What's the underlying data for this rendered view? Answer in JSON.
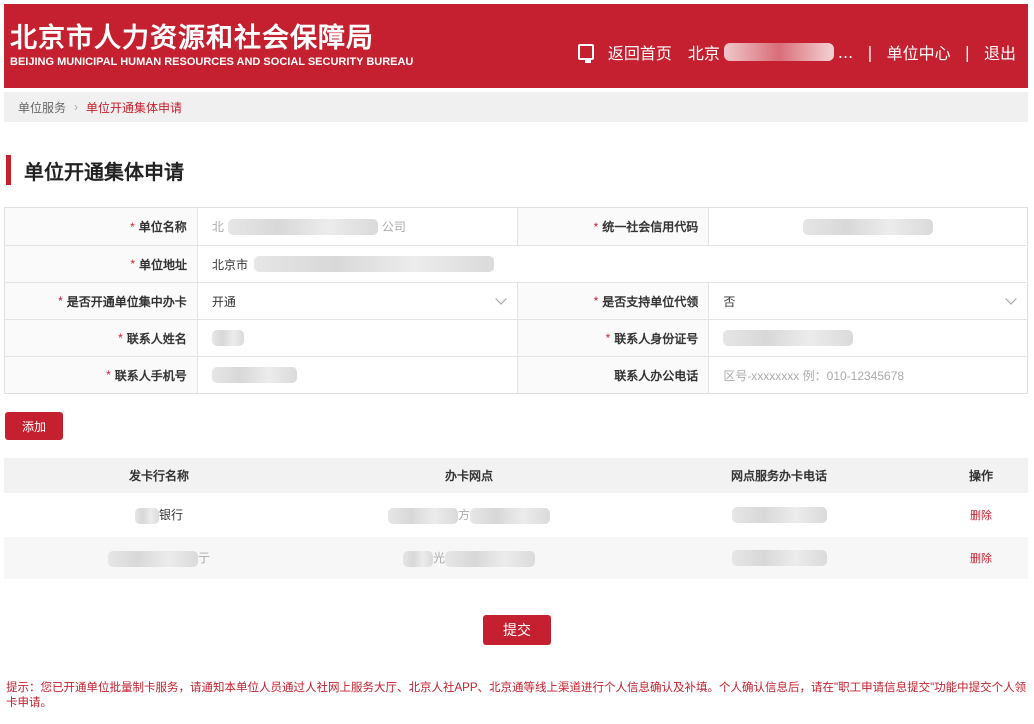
{
  "header": {
    "title_cn": "北京市人力资源和社会保障局",
    "title_en": "BEIJING MUNICIPAL HUMAN RESOURCES AND SOCIAL SECURITY BUREAU",
    "nav_home": "返回首页",
    "nav_user_prefix": "北京",
    "nav_user_suffix": "...",
    "nav_sep": "|",
    "nav_unit_center": "单位中心",
    "nav_logout": "退出"
  },
  "breadcrumb": {
    "parent": "单位服务",
    "arrow": "›",
    "current": "单位开通集体申请"
  },
  "page_title": "单位开通集体申请",
  "form": {
    "required_mark": "*",
    "unit_name_label": "单位名称",
    "unit_name_prefix": "北",
    "unit_name_suffix": "公司",
    "credit_code_label": "统一社会信用代码",
    "address_label": "单位地址",
    "address_prefix": "北京市",
    "collective_card_label": "是否开通单位集中办卡",
    "collective_card_value": "开通",
    "proxy_collect_label": "是否支持单位代领",
    "proxy_collect_value": "否",
    "contact_name_label": "联系人姓名",
    "contact_id_label": "联系人身份证号",
    "contact_mobile_label": "联系人手机号",
    "contact_office_phone_label": "联系人办公电话",
    "contact_office_phone_placeholder": "区号-xxxxxxxx 例：010-12345678"
  },
  "add_button": "添加",
  "bank_table": {
    "headers": [
      "发卡行名称",
      "办卡网点",
      "网点服务办卡电话",
      "操作"
    ],
    "rows": [
      {
        "bank_suffix": "银行",
        "branch_mid": "方",
        "action": "删除"
      },
      {
        "bank_suffix": "亍",
        "branch_mid": "光",
        "action": "删除"
      }
    ]
  },
  "submit_button": "提交",
  "tip": "提示：您已开通单位批量制卡服务，请通知本单位人员通过人社网上服务大厅、北京人社APP、北京通等线上渠道进行个人信息确认及补填。个人确认信息后，请在\"职工申请信息提交\"功能中提交个人领卡申请。"
}
